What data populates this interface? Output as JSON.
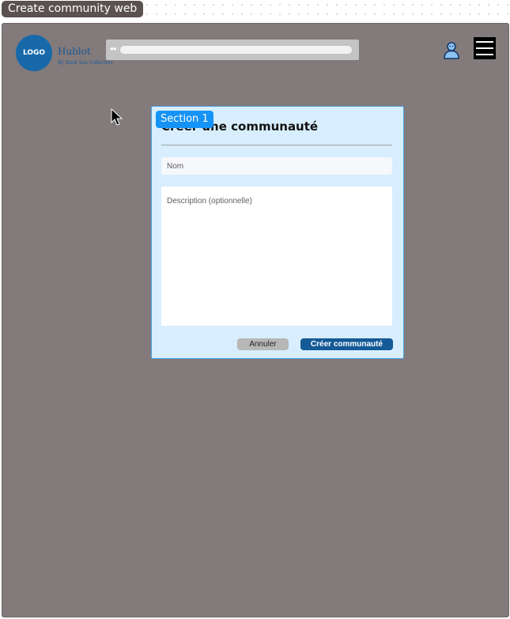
{
  "frame_label": "Create community web",
  "header": {
    "logo_text": "LOGO",
    "brand_name": "Hublot",
    "brand_tagline": "By Dark Sea Collective",
    "search": {
      "dots": "●●",
      "value": "",
      "placeholder": ""
    },
    "icons": {
      "user": "user-icon",
      "menu": "hamburger-menu-icon"
    }
  },
  "modal": {
    "section_badge": "Section 1",
    "title": "Créer une communauté",
    "name_placeholder": "Nom",
    "name_value": "",
    "description_placeholder": "Description (optionnelle)",
    "description_value": "",
    "cancel_label": "Annuler",
    "create_label": "Créer communauté"
  },
  "colors": {
    "frame_background": "#827a7b",
    "modal_background": "#d8eefe",
    "modal_border": "#4aa1e6",
    "badge": "#1593f6",
    "primary_button": "#145a96",
    "secondary_button": "#b7b7b7",
    "logo": "#1769aa"
  }
}
